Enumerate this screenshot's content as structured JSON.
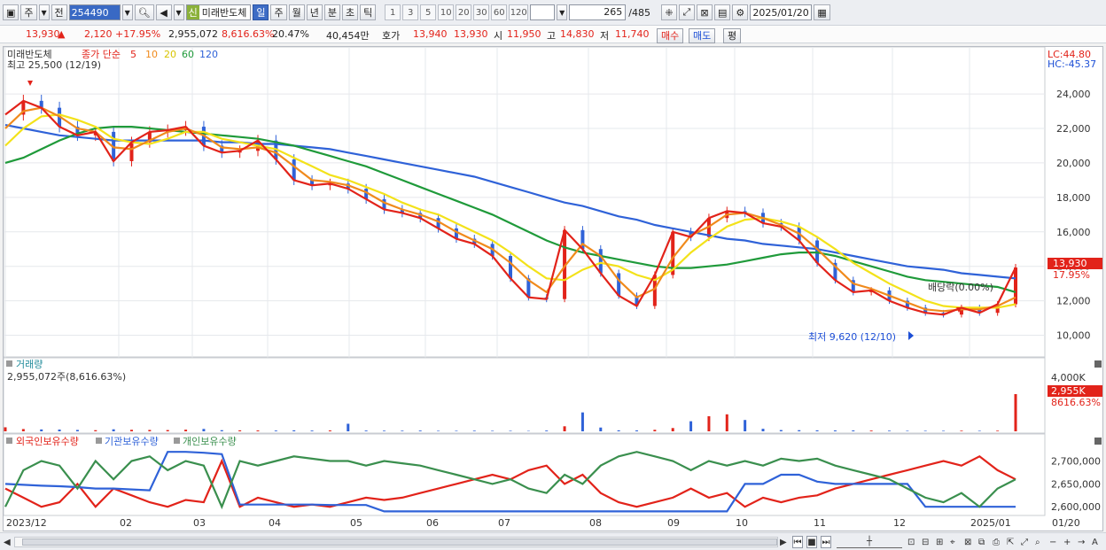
{
  "toolbar": {
    "market_label": "주",
    "prev_label": "전",
    "code": "254490",
    "sin_label": "신",
    "stock_name": "미래반도체",
    "periods": [
      "일",
      "주",
      "월",
      "년",
      "분",
      "초",
      "틱"
    ],
    "period_selected": 0,
    "intervals": [
      "1",
      "3",
      "5",
      "10",
      "20",
      "30",
      "60",
      "120"
    ],
    "count": "265",
    "total": "/485",
    "date": "2025/01/20"
  },
  "quote": {
    "price": "13,930",
    "arrow": "▲",
    "change": "2,120",
    "change_pct": "+17.95%",
    "volume": "2,955,072",
    "vol_ratio": "8,616.63%",
    "turnover": "20.47%",
    "ask_qty": "40,454만",
    "ask_label": "호가",
    "ask_price": "13,940",
    "bid_price": "13,930",
    "open_label": "시",
    "open": "11,950",
    "high_label": "고",
    "high": "14,830",
    "low_label": "저",
    "low": "11,740",
    "buy_label": "매수",
    "sell_label": "매도",
    "avg_label": "평"
  },
  "price_panel": {
    "title": "미래반도체",
    "legend_prefix": "종가 단순",
    "ma_periods": [
      "5",
      "10",
      "20",
      "60",
      "120"
    ],
    "ma_colors": [
      "#e2231a",
      "#f08a1c",
      "#f3e21a",
      "#1f9a3a",
      "#2f62d8"
    ],
    "high_marker": "최고 25,500 (12/19)",
    "low_marker": "최저 9,620 (12/10)",
    "dividend_label": "배당락(0.00%)",
    "lc": "LC:44.80",
    "hc": "HC:-45.37",
    "current_tag": "13,930",
    "current_pct": "17.95%"
  },
  "volume_panel": {
    "title": "거래량",
    "value": "2,955,072주(8,616.63%)",
    "scale_label": "4,000K",
    "current_tag": "2,955K",
    "current_pct": "8616.63%"
  },
  "holding_panel": {
    "legend": [
      "외국인보유수량",
      "기관보유수량",
      "개인보유수량"
    ],
    "colors": [
      "#e2231a",
      "#2f62d8",
      "#3a8f4e"
    ],
    "axis_labels": [
      "2,700,000",
      "2,650,000",
      "2,600,000"
    ]
  },
  "date_axis": [
    "2023/12",
    "02",
    "03",
    "04",
    "05",
    "06",
    "07",
    "08",
    "09",
    "10",
    "11",
    "12",
    "2025/01"
  ],
  "date_axis_right": "01/20",
  "chart_data": [
    {
      "type": "line",
      "title": "미래반도체",
      "ylim": [
        9000,
        25700
      ],
      "y_ticks": [
        "24,000",
        "22,000",
        "20,000",
        "18,000",
        "16,000",
        "14,000",
        "12,000",
        "10,000"
      ],
      "y_tick_values": [
        24000,
        22000,
        20000,
        18000,
        16000,
        14000,
        12000,
        10000
      ],
      "series": [
        {
          "name": "5",
          "values": [
            22800,
            23600,
            23200,
            22100,
            21600,
            21800,
            20100,
            21200,
            21800,
            21900,
            22100,
            21000,
            20600,
            20700,
            21300,
            20200,
            19000,
            18700,
            18800,
            18500,
            17900,
            17300,
            17100,
            16800,
            16200,
            15600,
            15300,
            14600,
            13300,
            12200,
            12100,
            16100,
            15000,
            13600,
            12300,
            11700,
            13500,
            16000,
            15700,
            16800,
            17200,
            17100,
            16500,
            16300,
            15500,
            14200,
            13200,
            12500,
            12600,
            12000,
            11600,
            11300,
            11200,
            11600,
            11300,
            11800,
            13930
          ]
        },
        {
          "name": "10",
          "values": [
            22000,
            23000,
            23200,
            22700,
            22000,
            21800,
            20900,
            20800,
            21300,
            21800,
            22000,
            21600,
            20900,
            20800,
            20900,
            20600,
            19800,
            19000,
            18900,
            18700,
            18300,
            17700,
            17300,
            17000,
            16600,
            16000,
            15500,
            15000,
            14200,
            13200,
            12500,
            14000,
            15300,
            14600,
            13200,
            12200,
            12700,
            14500,
            15800,
            16300,
            17000,
            17100,
            16800,
            16400,
            15900,
            15000,
            14000,
            13000,
            12700,
            12300,
            11900,
            11500,
            11400,
            11500,
            11500,
            11700,
            12200
          ]
        },
        {
          "name": "20",
          "values": [
            21000,
            22000,
            22700,
            22800,
            22500,
            22100,
            21400,
            21200,
            21100,
            21400,
            21800,
            21800,
            21400,
            21200,
            21000,
            20800,
            20300,
            19800,
            19300,
            19000,
            18600,
            18200,
            17700,
            17300,
            17000,
            16500,
            16000,
            15500,
            14800,
            14000,
            13300,
            13200,
            13800,
            14200,
            14000,
            13500,
            13200,
            13800,
            14800,
            15600,
            16300,
            16700,
            16800,
            16600,
            16300,
            15700,
            15000,
            14200,
            13600,
            13000,
            12500,
            12000,
            11700,
            11600,
            11600,
            11600,
            11800
          ]
        },
        {
          "name": "60",
          "values": [
            20000,
            20300,
            20800,
            21300,
            21700,
            22000,
            22100,
            22100,
            22000,
            21900,
            21800,
            21700,
            21600,
            21500,
            21400,
            21200,
            21000,
            20700,
            20400,
            20100,
            19800,
            19400,
            19000,
            18600,
            18200,
            17800,
            17400,
            17000,
            16500,
            16000,
            15500,
            15100,
            14800,
            14600,
            14400,
            14200,
            14000,
            13900,
            13900,
            14000,
            14100,
            14300,
            14500,
            14700,
            14800,
            14800,
            14600,
            14300,
            14000,
            13700,
            13400,
            13200,
            13100,
            13000,
            12900,
            12800,
            12500
          ]
        },
        {
          "name": "120",
          "values": [
            22200,
            22000,
            21800,
            21600,
            21500,
            21400,
            21300,
            21300,
            21300,
            21300,
            21300,
            21300,
            21200,
            21200,
            21100,
            21100,
            21000,
            20900,
            20800,
            20600,
            20400,
            20200,
            20000,
            19800,
            19600,
            19400,
            19200,
            18900,
            18600,
            18300,
            18000,
            17700,
            17500,
            17200,
            16900,
            16700,
            16400,
            16200,
            16000,
            15800,
            15600,
            15500,
            15300,
            15200,
            15100,
            15000,
            14800,
            14600,
            14400,
            14200,
            14000,
            13900,
            13800,
            13600,
            13500,
            13400,
            13300
          ]
        }
      ]
    },
    {
      "type": "bar",
      "title": "거래량",
      "ylim": [
        0,
        4500
      ],
      "values": [
        320,
        180,
        150,
        140,
        110,
        90,
        160,
        120,
        110,
        100,
        130,
        190,
        90,
        80,
        70,
        60,
        80,
        60,
        70,
        600,
        60,
        50,
        50,
        60,
        40,
        40,
        50,
        40,
        40,
        30,
        60,
        400,
        1500,
        300,
        80,
        70,
        120,
        260,
        800,
        1200,
        1350,
        900,
        200,
        100,
        90,
        80,
        70,
        70,
        60,
        50,
        40,
        40,
        40,
        50,
        40,
        50,
        2955
      ]
    },
    {
      "type": "line",
      "title": "보유수량",
      "ylim": [
        2585000,
        2730000
      ],
      "y_ticks": [
        "2,700,000",
        "2,650,000",
        "2,600,000"
      ],
      "series": [
        {
          "name": "외국인보유수량",
          "values": [
            2640000,
            2620000,
            2600000,
            2610000,
            2650000,
            2600000,
            2640000,
            2625000,
            2610000,
            2600000,
            2615000,
            2610000,
            2700000,
            2600000,
            2620000,
            2610000,
            2600000,
            2605000,
            2600000,
            2610000,
            2620000,
            2615000,
            2620000,
            2630000,
            2640000,
            2650000,
            2660000,
            2670000,
            2660000,
            2680000,
            2690000,
            2650000,
            2670000,
            2630000,
            2610000,
            2600000,
            2610000,
            2620000,
            2640000,
            2620000,
            2630000,
            2600000,
            2620000,
            2610000,
            2620000,
            2625000,
            2640000,
            2650000,
            2660000,
            2670000,
            2680000,
            2690000,
            2700000,
            2690000,
            2710000,
            2680000,
            2660000
          ]
        },
        {
          "name": "기관보유수량",
          "values": [
            2650000,
            2648000,
            2646000,
            2645000,
            2643000,
            2640000,
            2640000,
            2638000,
            2636000,
            2720000,
            2720000,
            2718000,
            2715000,
            2605000,
            2605000,
            2605000,
            2605000,
            2605000,
            2604000,
            2604000,
            2604000,
            2590000,
            2590000,
            2590000,
            2590000,
            2590000,
            2590000,
            2590000,
            2590000,
            2590000,
            2590000,
            2590000,
            2590000,
            2590000,
            2590000,
            2590000,
            2590000,
            2590000,
            2590000,
            2590000,
            2590000,
            2650000,
            2650000,
            2670000,
            2670000,
            2655000,
            2650000,
            2650000,
            2650000,
            2650000,
            2650000,
            2600000,
            2600000,
            2600000,
            2600000,
            2600000,
            2600000
          ]
        },
        {
          "name": "개인보유수량",
          "values": [
            2600000,
            2680000,
            2700000,
            2690000,
            2640000,
            2700000,
            2660000,
            2700000,
            2710000,
            2680000,
            2700000,
            2690000,
            2600000,
            2700000,
            2690000,
            2700000,
            2710000,
            2705000,
            2700000,
            2700000,
            2690000,
            2700000,
            2695000,
            2690000,
            2680000,
            2670000,
            2660000,
            2650000,
            2660000,
            2640000,
            2630000,
            2670000,
            2650000,
            2690000,
            2710000,
            2720000,
            2710000,
            2700000,
            2680000,
            2700000,
            2690000,
            2700000,
            2690000,
            2705000,
            2700000,
            2705000,
            2690000,
            2680000,
            2670000,
            2660000,
            2640000,
            2620000,
            2610000,
            2630000,
            2600000,
            2640000,
            2660000
          ]
        }
      ]
    }
  ]
}
